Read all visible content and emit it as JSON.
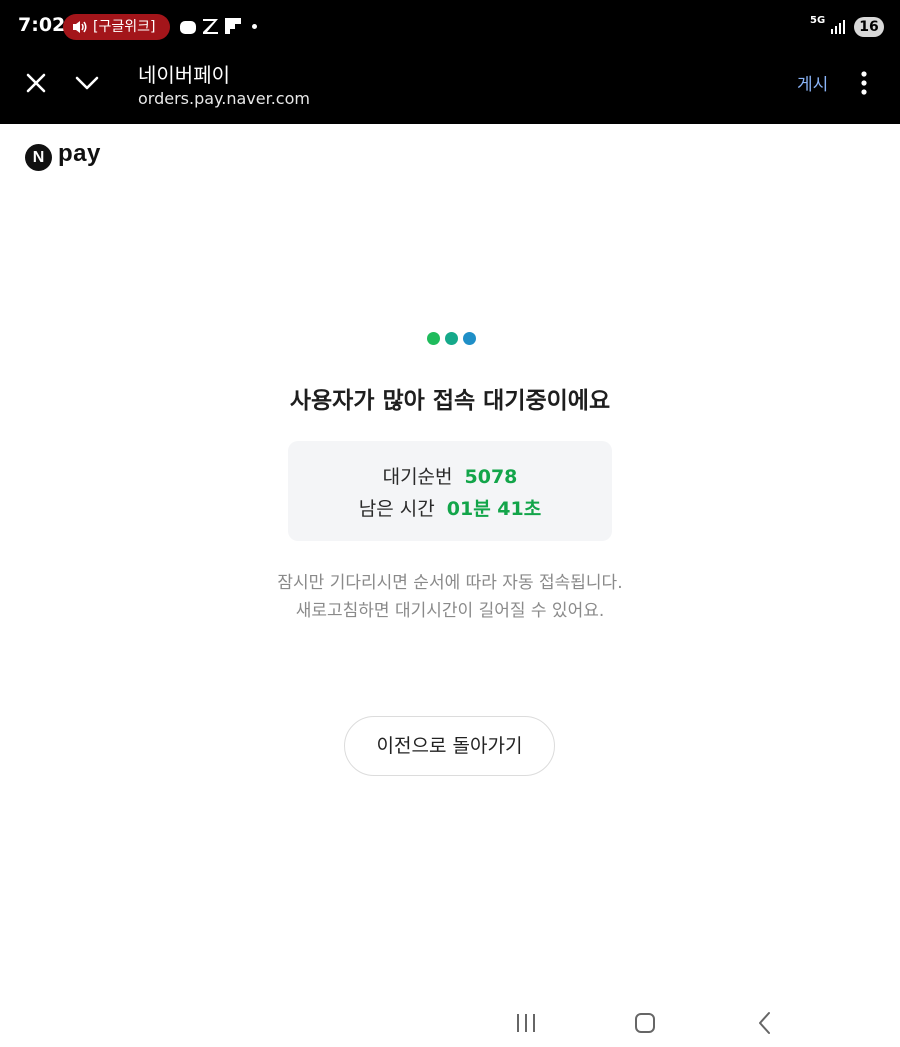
{
  "status_bar": {
    "time": "7:02",
    "alert_pill": "[구글위크]",
    "network": "5G",
    "battery": "16",
    "icons": [
      "speaker-icon",
      "notification-app-icon",
      "z-app-icon",
      "flipboard-icon",
      "more-dot-icon",
      "network-icon",
      "signal-icon",
      "battery-icon"
    ],
    "colors": {
      "background": "#000000",
      "pill": "#a3151a"
    }
  },
  "app_bar": {
    "title": "네이버페이",
    "url": "orders.pay.naver.com",
    "post_button": "게시",
    "icons": [
      "close-icon",
      "chevron-down-icon",
      "more-vert-icon"
    ]
  },
  "logo": {
    "mark": "N",
    "text": "pay"
  },
  "loading_dots": {
    "colors": [
      "#1fbb5c",
      "#15a98a",
      "#1f8fc7"
    ]
  },
  "headline": "사용자가 많아 접속 대기중이에요",
  "queue": {
    "number_label": "대기순번",
    "number_value": "5078",
    "time_label": "남은 시간",
    "time_value": "01분 41초",
    "accent_color": "#13a54a"
  },
  "info_lines": [
    "잠시만 기다리시면 순서에 따라 자동 접속됩니다.",
    "새로고침하면 대기시간이 길어질 수 있어요."
  ],
  "back_button": "이전으로 돌아가기",
  "nav": {
    "icons": [
      "recents-icon",
      "home-icon",
      "back-icon"
    ]
  }
}
